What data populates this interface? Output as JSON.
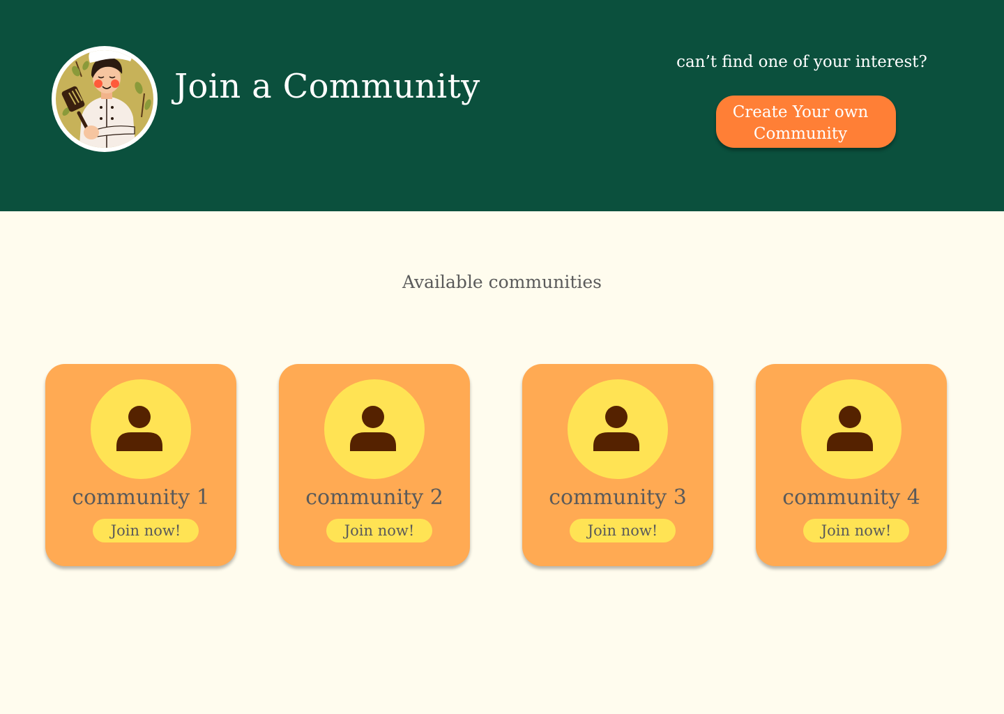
{
  "colors": {
    "header_background": "#0B503D",
    "page_background": "#FFFCEE",
    "primary_button": "#FF7F36",
    "card_background": "#FFAA53",
    "card_accent": "#FFE354",
    "avatar_icon": "#552200",
    "muted_text": "#5A5A5A"
  },
  "header": {
    "logo_icon": "chef-illustration-icon",
    "title": "Join a Community",
    "cta_question": "can’t find one of  your interest?",
    "create_button": {
      "line1": "Create Your own",
      "line2": "Community"
    }
  },
  "main": {
    "section_title": "Available communities",
    "communities": [
      {
        "name": "community 1",
        "join_label": "Join now!",
        "icon": "user-icon"
      },
      {
        "name": "community 2",
        "join_label": "Join now!",
        "icon": "user-icon"
      },
      {
        "name": "community 3",
        "join_label": "Join now!",
        "icon": "user-icon"
      },
      {
        "name": "community 4",
        "join_label": "Join now!",
        "icon": "user-icon"
      }
    ]
  }
}
